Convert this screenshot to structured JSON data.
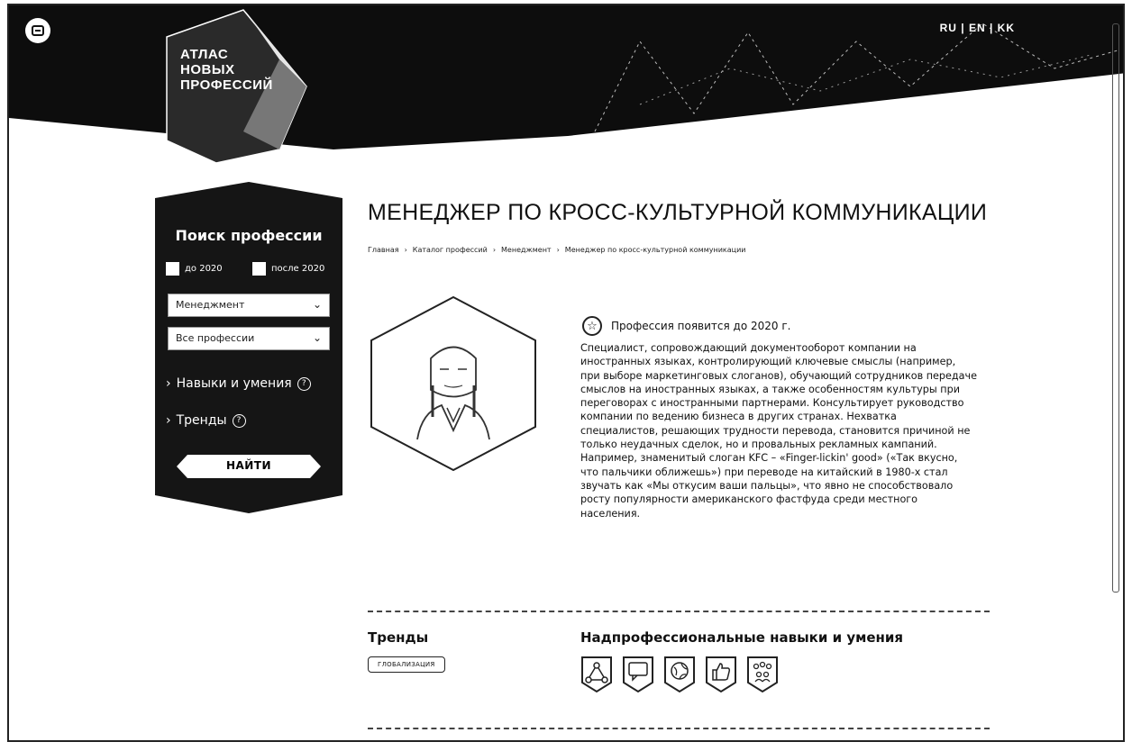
{
  "header": {
    "logo_lines": [
      "АТЛАС",
      "НОВЫХ",
      "ПРОФЕССИЙ"
    ],
    "lang": "RU | EN | KK"
  },
  "sidebar": {
    "title": "Поиск профессии",
    "check_before": "до 2020",
    "check_after": "после 2020",
    "select_field": "Менеджмент",
    "select_profession": "Все профессии",
    "skills_link": "Навыки и умения",
    "trends_link": "Тренды",
    "find_button": "НАЙТИ"
  },
  "page": {
    "title": "МЕНЕДЖЕР ПО КРОСС-КУЛЬТУРНОЙ КОММУНИКАЦИИ",
    "breadcrumbs": [
      "Главная",
      "Каталог профессий",
      "Менеджмент",
      "Менеджер по кросс-культурной коммуникации"
    ],
    "badge": "Профессия появится до 2020 г.",
    "description": "Специалист, сопровождающий документооборот компании на иностранных языках, контролирующий ключевые смыслы (например, при выборе маркетинговых слоганов), обучающий сотрудников передаче смыслов на иностранных языках, а также особенностям культуры при переговорах с иностранными партнерами. Консультирует руководство компании по ведению бизнеса в других странах. Нехватка специалистов, решающих трудности перевода, становится причиной не только неудачных сделок, но и провальных рекламных кампаний. Например, знаменитый слоган KFC – «Finger-lickin' good» («Так вкусно, что пальчики оближешь») при переводе на китайский в 1980-х стал звучать как «Мы откусим ваши пальцы», что явно не способствовало росту популярности американского фастфуда среди местного населения."
  },
  "trends": {
    "heading": "Тренды",
    "tag": "ГЛОБАЛИЗАЦИЯ"
  },
  "skills": {
    "heading": "Надпрофессиональные навыки и умения",
    "icons": [
      "systems-thinking-icon",
      "communication-icon",
      "multilingual-icon",
      "client-orientation-icon",
      "team-work-icon"
    ]
  },
  "colors": {
    "dark": "#111111",
    "white": "#ffffff"
  }
}
